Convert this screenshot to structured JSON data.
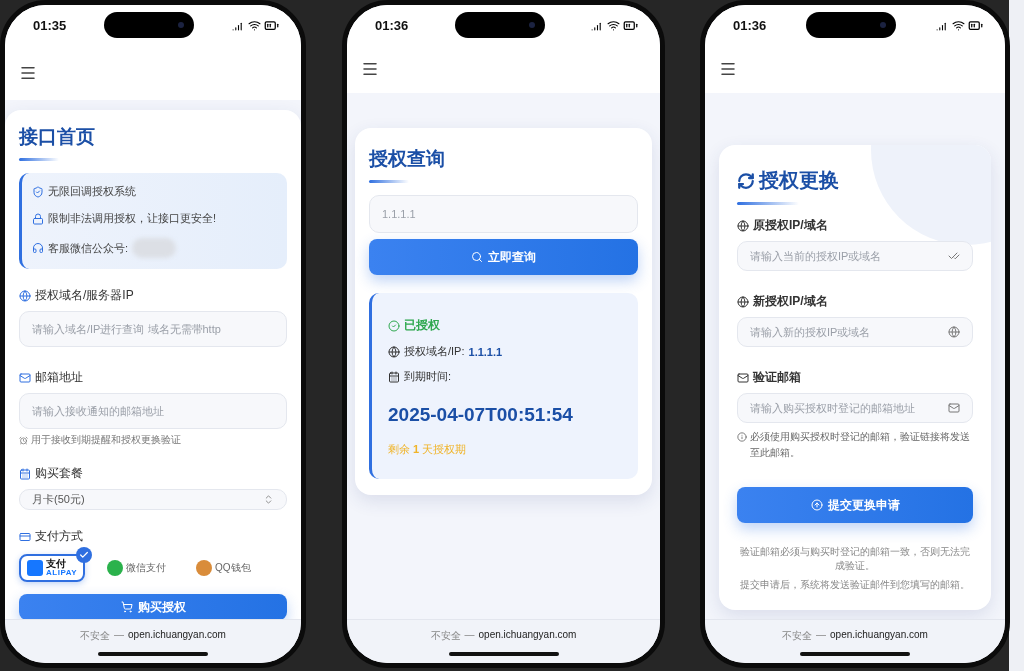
{
  "phones": [
    {
      "kind": "home",
      "status_time": "01:35",
      "url": {
        "security": "不安全",
        "separator": "—",
        "domain": "open.ichuangyan.com"
      },
      "title": "接口首页",
      "notice": [
        {
          "text": "无限回调授权系统",
          "redacted": false
        },
        {
          "text": "限制非法调用授权，让接口更安全!",
          "redacted": false
        },
        {
          "text": "客服微信公众号:",
          "redacted": true
        }
      ],
      "fields": [
        {
          "kind": "input",
          "label": "授权域名/服务器IP",
          "placeholder": "请输入域名/IP进行查询 域名无需带http"
        },
        {
          "kind": "input",
          "label": "邮箱地址",
          "placeholder": "请输入接收通知的邮箱地址",
          "hint": "用于接收到期提醒和授权更换验证"
        },
        {
          "kind": "select",
          "label": "购买套餐",
          "value": "月卡(50元)"
        }
      ],
      "payment": {
        "label": "支付方式",
        "options": [
          {
            "kind": "alipay",
            "label": "支付",
            "sublabel": "ALIPAY",
            "selected": true
          },
          {
            "kind": "wechat",
            "label": "微信支付",
            "selected": false
          },
          {
            "kind": "qq",
            "label": "QQ钱包",
            "selected": false
          }
        ]
      },
      "button": "购买授权"
    },
    {
      "kind": "query",
      "status_time": "01:36",
      "url": {
        "security": "不安全",
        "separator": "—",
        "domain": "open.ichuangyan.com"
      },
      "title": "授权查询",
      "search": {
        "placeholder": "1.1.1.1"
      },
      "button": "立即查询",
      "result": {
        "authorized": true,
        "status": "已授权",
        "domain_label": "授权域名/IP:",
        "domain": "1.1.1.1",
        "expiry_label": "到期时间:",
        "expiry": "2025-04-07T00:51:54",
        "remaining": "剩余 **1** 天授权期"
      }
    },
    {
      "kind": "change",
      "status_time": "01:36",
      "url": {
        "security": "不安全",
        "separator": "—",
        "domain": "open.ichuangyan.com"
      },
      "title": "授权更换",
      "fields": [
        {
          "label": "原授权IP/域名",
          "placeholder": "请输入当前的授权IP或域名"
        },
        {
          "label": "新授权IP/域名",
          "placeholder": "请输入新的授权IP或域名"
        },
        {
          "label": "验证邮箱",
          "placeholder": "请输入购买授权时登记的邮箱地址"
        }
      ],
      "note": "必须使用购买授权时登记的邮箱，验证链接将发送至此邮箱。",
      "button": "提交更换申请",
      "footer": [
        "验证邮箱必须与购买时登记的邮箱一致，否则无法完成验证。",
        "提交申请后，系统将发送验证邮件到您填写的邮箱。"
      ]
    }
  ]
}
